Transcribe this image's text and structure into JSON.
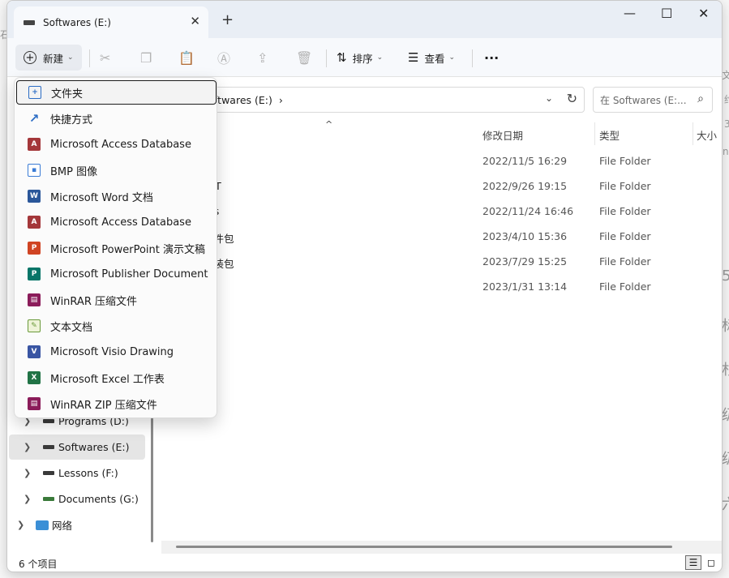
{
  "background": {
    "left_char": "石",
    "right_chars": [
      "文",
      "约",
      "3",
      "n",
      "5",
      "标",
      "杉",
      "级",
      "级",
      "六"
    ]
  },
  "window": {
    "tab_title": "Softwares (E:)",
    "close_tab": "✕",
    "new_tab": "+",
    "controls": {
      "minimize": "—",
      "maximize": "☐",
      "close": "✕"
    }
  },
  "toolbar": {
    "new_label": "新建",
    "sort_label": "排序",
    "view_label": "查看",
    "more_label": "···"
  },
  "address": {
    "path": "ftwares (E:)",
    "separator": "›",
    "search_placeholder": "在 Softwares (E:..."
  },
  "columns": {
    "date": "修改日期",
    "type": "类型",
    "size": "大小",
    "sort_arrow": "^"
  },
  "rows": [
    {
      "name": "",
      "date": "2022/11/5 16:29",
      "type": "File Folder"
    },
    {
      "name": "M-T",
      "date": "2022/9/26 19:15",
      "type": "File Folder"
    },
    {
      "name": "ors",
      "date": "2022/11/24 16:46",
      "type": "File Folder"
    },
    {
      "name": "文件包",
      "date": "2023/4/10 15:36",
      "type": "File Folder"
    },
    {
      "name": "安装包",
      "date": "2023/7/29 15:25",
      "type": "File Folder"
    },
    {
      "name": "",
      "date": "2023/1/31 13:14",
      "type": "File Folder"
    }
  ],
  "nav": [
    {
      "label": "Programs (D:)",
      "selected": false
    },
    {
      "label": "Softwares (E:)",
      "selected": true
    },
    {
      "label": "Lessons (F:)",
      "selected": false
    },
    {
      "label": "Documents (G:)",
      "selected": false
    },
    {
      "label": "网络",
      "selected": false
    }
  ],
  "status": {
    "count": "6 个项目"
  },
  "menu": [
    {
      "label": "文件夹",
      "icon": "folder-plus-icon",
      "color": "#2b6cc4"
    },
    {
      "label": "快捷方式",
      "icon": "shortcut-arrow-icon",
      "color": "#2b6cc4"
    },
    {
      "label": "Microsoft Access Database",
      "icon": "access-icon",
      "color": "#a4373a"
    },
    {
      "label": "BMP 图像",
      "icon": "bmp-image-icon",
      "color": "#3a7bd5"
    },
    {
      "label": "Microsoft Word 文档",
      "icon": "word-icon",
      "color": "#2b579a"
    },
    {
      "label": "Microsoft Access Database",
      "icon": "access-icon",
      "color": "#a4373a"
    },
    {
      "label": "Microsoft PowerPoint 演示文稿",
      "icon": "powerpoint-icon",
      "color": "#d04423"
    },
    {
      "label": "Microsoft Publisher Document",
      "icon": "publisher-icon",
      "color": "#077568"
    },
    {
      "label": "WinRAR 压缩文件",
      "icon": "winrar-icon",
      "color": "#8b1c5a"
    },
    {
      "label": "文本文档",
      "icon": "text-document-icon",
      "color": "#6a9a3a"
    },
    {
      "label": "Microsoft Visio Drawing",
      "icon": "visio-icon",
      "color": "#3955a3"
    },
    {
      "label": "Microsoft Excel 工作表",
      "icon": "excel-icon",
      "color": "#217346"
    },
    {
      "label": "WinRAR ZIP 压缩文件",
      "icon": "winrar-zip-icon",
      "color": "#8b1c5a"
    }
  ]
}
